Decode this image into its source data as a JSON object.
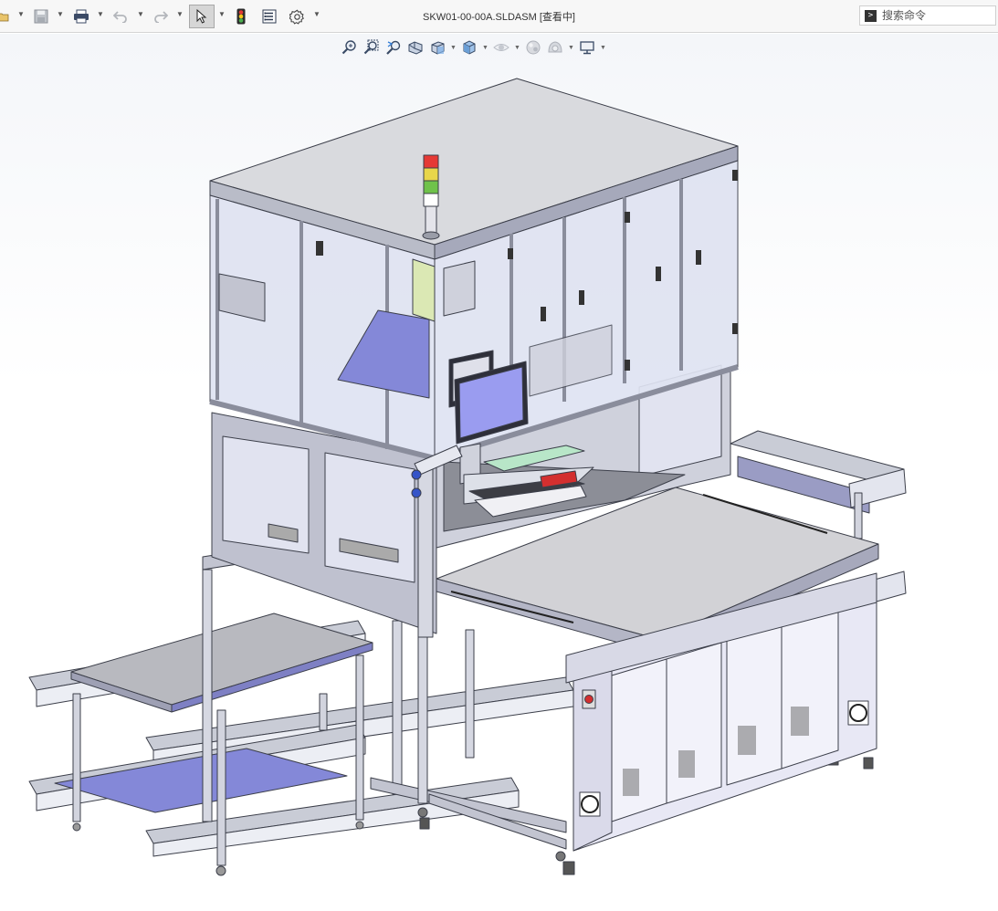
{
  "window": {
    "document_title": "SKW01-00-00A.SLDASM [查看中]"
  },
  "toolbar": {
    "buttons": [
      {
        "name": "open-icon",
        "icon": "folder"
      },
      {
        "name": "save-icon",
        "icon": "floppy-disk"
      },
      {
        "name": "print-icon",
        "icon": "printer"
      },
      {
        "name": "undo-icon",
        "icon": "undo"
      },
      {
        "name": "redo-icon",
        "icon": "redo"
      },
      {
        "name": "select-icon",
        "icon": "pointer"
      },
      {
        "name": "rebuild-icon",
        "icon": "traffic-light"
      },
      {
        "name": "file-properties-icon",
        "icon": "properties"
      },
      {
        "name": "options-icon",
        "icon": "gear"
      }
    ]
  },
  "search": {
    "placeholder": "搜索命令"
  },
  "heads_up_toolbar": {
    "tools": [
      "zoom-to-fit",
      "zoom-to-area",
      "previous-view",
      "section-view",
      "view-orientation",
      "display-style",
      "hide-show-items",
      "edit-appearance",
      "apply-scene",
      "view-settings"
    ]
  },
  "model": {
    "stack_light_colors": [
      "#e53935",
      "#e8d64a",
      "#6fc24a",
      "#ffffff"
    ],
    "frame_color": "#b9bcc8",
    "panel_color": "#c8cbe0",
    "glass_color": "#dfe3f2",
    "blue_panel_color": "#8488d8",
    "monitor_screen_color": "#9a9cf0",
    "cabinet_color": "#e6e6f4",
    "table_top_color": "#d2d2d6"
  }
}
